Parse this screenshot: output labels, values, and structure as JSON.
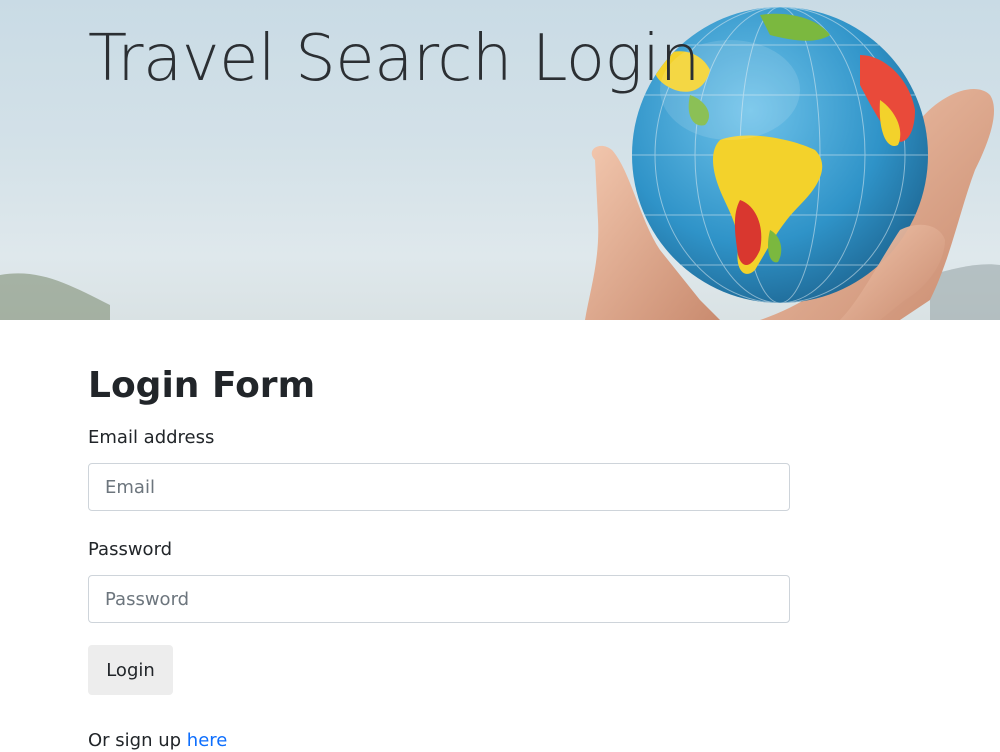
{
  "hero": {
    "title": "Travel Search Login"
  },
  "form": {
    "heading": "Login Form",
    "email_label": "Email address",
    "email_placeholder": "Email",
    "password_label": "Password",
    "password_placeholder": "Password",
    "submit_label": "Login",
    "signup_prefix": "Or sign up",
    "signup_link": "here"
  },
  "colors": {
    "link": "#0d6efd",
    "button_bg": "#ededed",
    "input_border": "#ced4da"
  }
}
